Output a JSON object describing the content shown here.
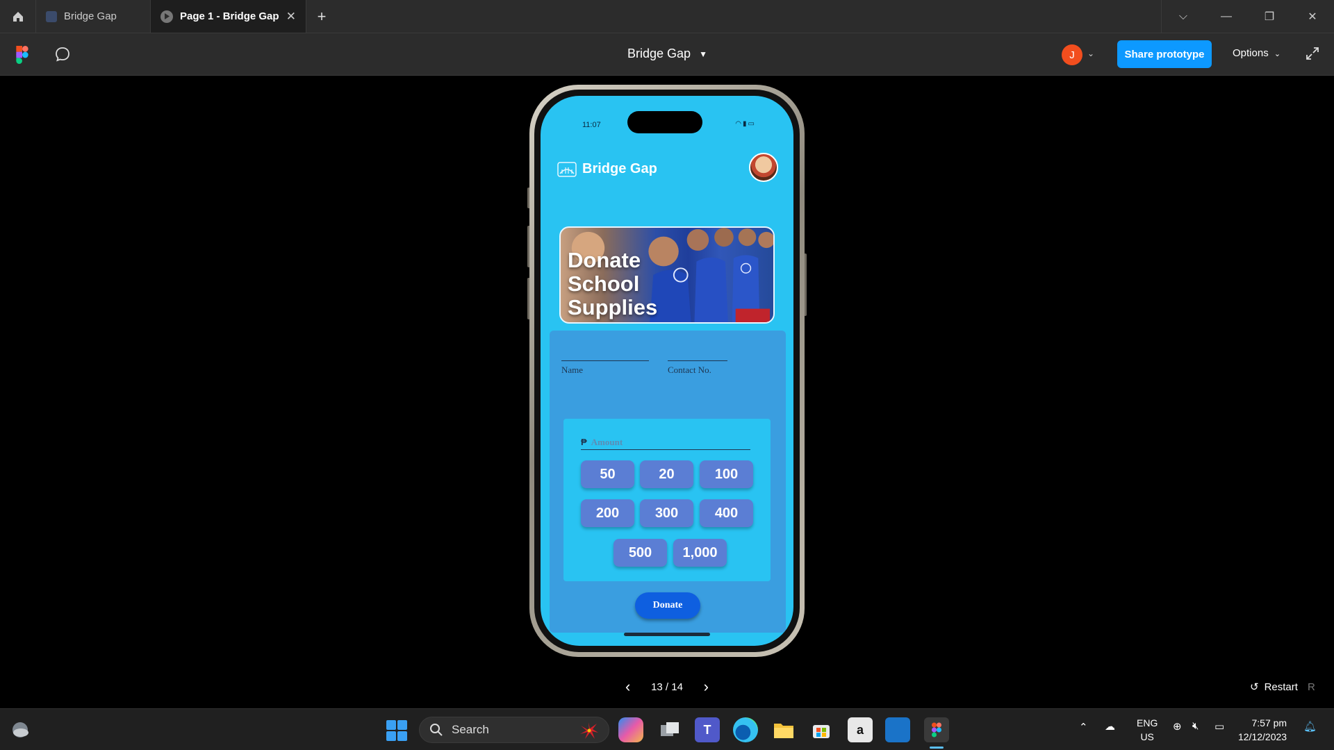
{
  "browser": {
    "tabs": [
      {
        "label": "Bridge Gap"
      },
      {
        "label": "Page 1 - Bridge Gap"
      }
    ]
  },
  "toolbar": {
    "doc_title": "Bridge Gap",
    "user_initial": "J",
    "share_label": "Share prototype",
    "options_label": "Options"
  },
  "phone": {
    "status_time": "11:07",
    "app_title": "Bridge Gap",
    "banner_text": "Donate\nSchool\nSupplies",
    "form": {
      "name_label": "Name",
      "contact_label": "Contact No.",
      "currency_symbol": "₱",
      "amount_placeholder": "Amount",
      "amounts": [
        "50",
        "20",
        "100",
        "200",
        "300",
        "400",
        "500",
        "1,000"
      ],
      "donate_label": "Donate"
    }
  },
  "pager": {
    "label": "13 / 14",
    "restart_label": "Restart",
    "restart_key": "R"
  },
  "taskbar": {
    "search_label": "Search",
    "lang_top": "ENG",
    "lang_bottom": "US",
    "time": "7:57 pm",
    "date": "12/12/2023"
  },
  "colors": {
    "screen_bg": "#29c3f2",
    "card_bg": "#3a9ee0",
    "amount_btn": "#5b7ed4",
    "donate_btn": "#0e5fe0",
    "share_btn": "#0d99ff"
  }
}
